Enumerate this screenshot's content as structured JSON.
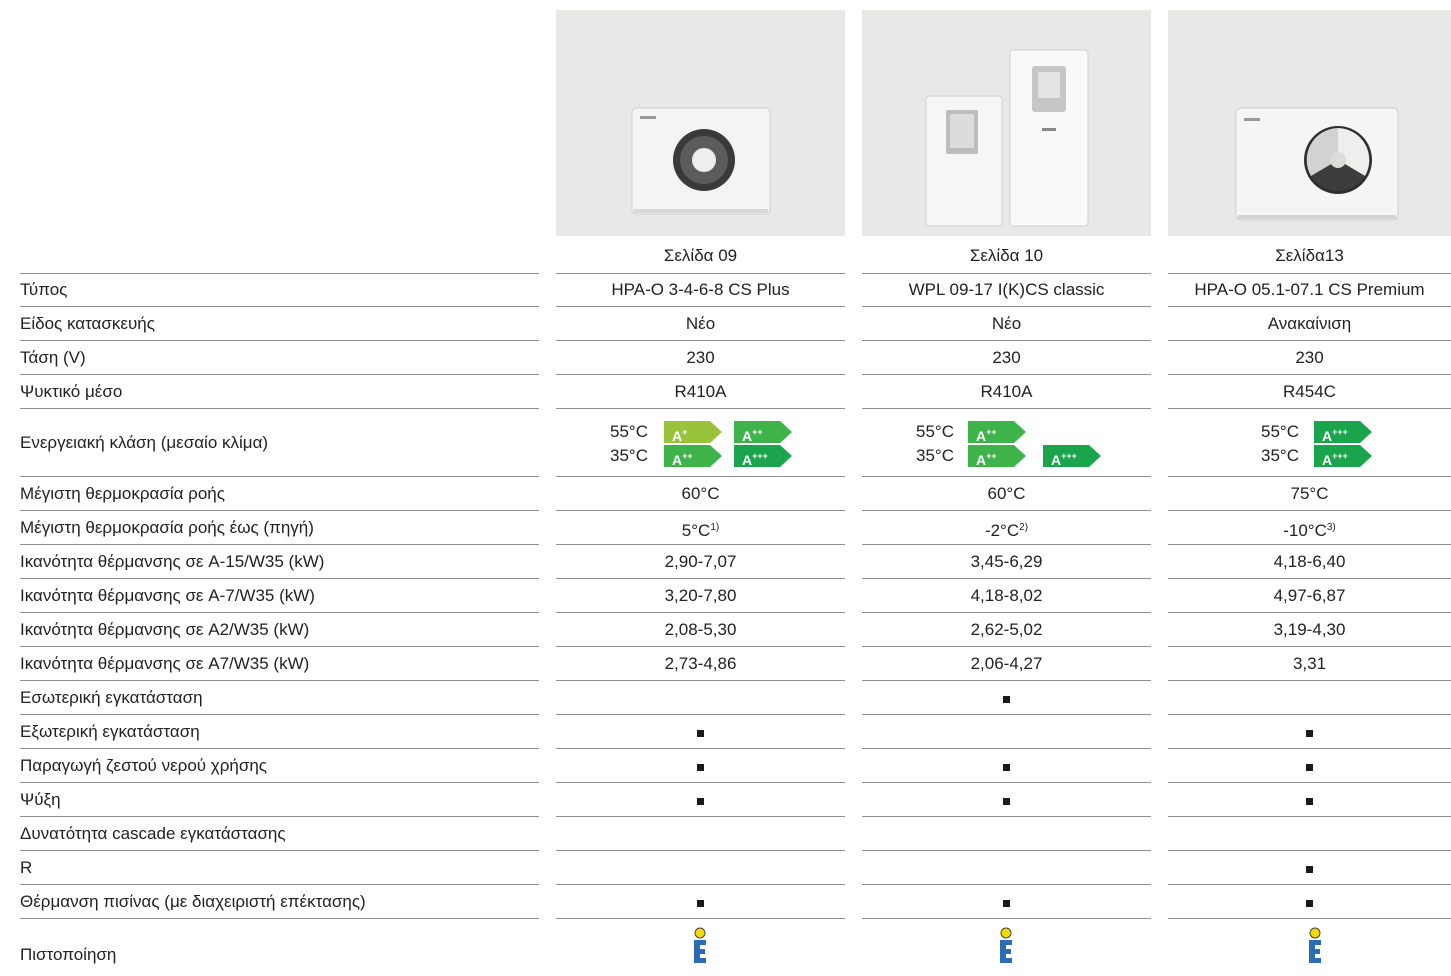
{
  "products": [
    {
      "page": "Σελίδα 09",
      "type": "HPA-O 3-4-6-8 CS Plus",
      "construction": "Νέο",
      "voltage": "230",
      "refrigerant": "R410A",
      "max_flow_temp": "60°C",
      "max_flow_temp_source": "5°C",
      "max_flow_temp_source_note": "1)",
      "cap_a15": "2,90-7,07",
      "cap_a7": "3,20-7,80",
      "cap_a2": "2,08-5,30",
      "cap_a7p": "2,73-4,86",
      "energy": [
        {
          "temp": "55°C",
          "classes": [
            {
              "base": "A",
              "sup": "+",
              "color": "#9ac33c"
            },
            {
              "base": "A",
              "sup": "++",
              "color": "#3db34a"
            }
          ]
        },
        {
          "temp": "35°C",
          "classes": [
            {
              "base": "A",
              "sup": "++",
              "color": "#3db34a"
            },
            {
              "base": "A",
              "sup": "+++",
              "color": "#1aa54c"
            }
          ]
        }
      ],
      "features": [
        false,
        true,
        true,
        true,
        false,
        false,
        true
      ]
    },
    {
      "page": "Σελίδα 10",
      "type": "WPL 09-17 I(K)CS classic",
      "construction": "Νέο",
      "voltage": "230",
      "refrigerant": "R410A",
      "max_flow_temp": "60°C",
      "max_flow_temp_source": "-2°C",
      "max_flow_temp_source_note": "2)",
      "cap_a15": "3,45-6,29",
      "cap_a7": "4,18-8,02",
      "cap_a2": "2,62-5,02",
      "cap_a7p": "2,06-4,27",
      "energy": [
        {
          "temp": "55°C",
          "classes": [
            {
              "base": "A",
              "sup": "++",
              "color": "#3db34a"
            }
          ]
        },
        {
          "temp": "35°C",
          "classes": [
            {
              "base": "A",
              "sup": "++",
              "color": "#3db34a"
            },
            {
              "base": "A",
              "sup": "+++",
              "color": "#1aa54c"
            }
          ]
        }
      ],
      "features": [
        true,
        false,
        true,
        true,
        false,
        false,
        true
      ]
    },
    {
      "page": "Σελίδα13",
      "type": "HPA-O 05.1-07.1 CS Premium",
      "construction": "Ανακαίνιση",
      "voltage": "230",
      "refrigerant": "R454C",
      "max_flow_temp": "75°C",
      "max_flow_temp_source": "-10°C",
      "max_flow_temp_source_note": "3)",
      "cap_a15": "4,18-6,40",
      "cap_a7": "4,97-6,87",
      "cap_a2": "3,19-4,30",
      "cap_a7p": "3,31",
      "energy": [
        {
          "temp": "55°C",
          "classes": [
            {
              "base": "A",
              "sup": "+++",
              "color": "#1aa54c"
            }
          ]
        },
        {
          "temp": "35°C",
          "classes": [
            {
              "base": "A",
              "sup": "+++",
              "color": "#1aa54c"
            }
          ]
        }
      ],
      "features": [
        false,
        true,
        true,
        true,
        false,
        true,
        true
      ]
    }
  ],
  "labels": {
    "type": "Τύπος",
    "construction": "Είδος κατασκευής",
    "voltage": "Τάση (V)",
    "refrigerant": "Ψυκτικό μέσο",
    "energy_class": "Ενεργειακή κλάση (μεσαίο κλίμα)",
    "max_flow_temp": "Μέγιστη θερμοκρασία ροής",
    "max_flow_temp_source": "Μέγιστη θερμοκρασία ροής έως (πηγή)",
    "cap_a15": "Ικανότητα θέρμανσης σε A-15/W35 (kW)",
    "cap_a7": "Ικανότητα θέρμανσης σε A-7/W35 (kW)",
    "cap_a2": "Ικανότητα θέρμανσης σε A2/W35 (kW)",
    "cap_a7p": "Ικανότητα θέρμανσης σε A7/W35 (kW)",
    "features": [
      "Εσωτερική εγκατάσταση",
      "Εξωτερική εγκατάσταση",
      "Παραγωγή ζεστού νερού χρήσης",
      "Ψύξη",
      "Δυνατότητα cascade εγκατάστασης",
      "R",
      "Θέρμανση πισίνας (με διαχειριστή επέκτασης)"
    ],
    "certification": "Πιστοποίηση"
  },
  "icons": {
    "feature_marker": "filled-square-icon",
    "certification": "certification-mark-icon",
    "product_image": "product-photo"
  },
  "colors": {
    "rule": "#8f8f8f",
    "image_bg": "#e8e8e7",
    "cert_blue": "#2a6db3",
    "cert_yellow": "#f2dc00"
  }
}
